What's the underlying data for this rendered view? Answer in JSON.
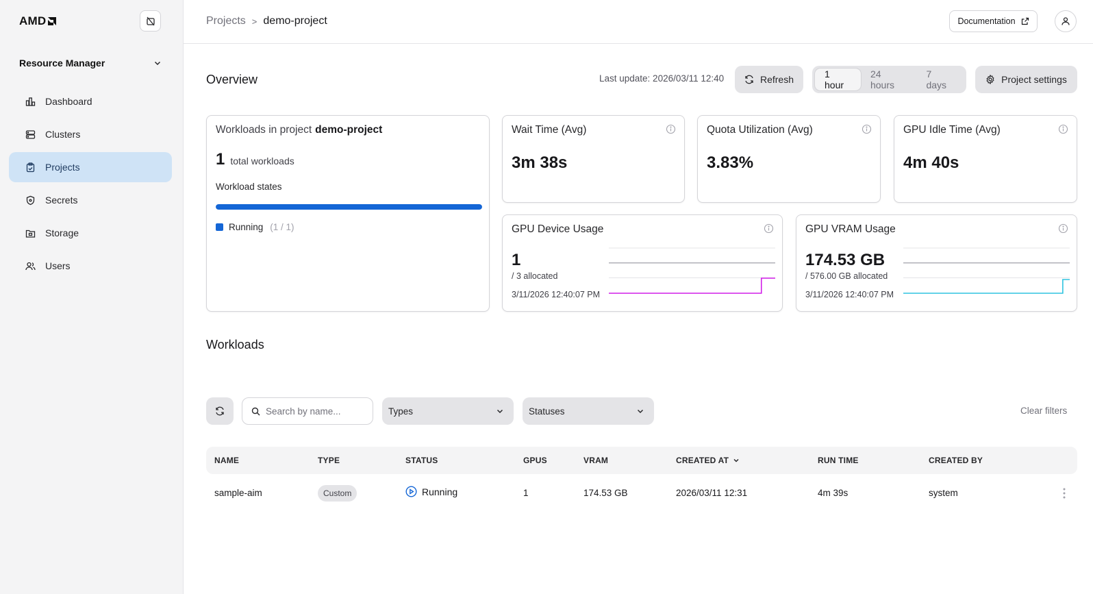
{
  "brand": {
    "name": "AMD"
  },
  "sidebar": {
    "section_label": "Resource Manager",
    "items": [
      {
        "label": "Dashboard",
        "icon": "bar-chart-icon",
        "active": false
      },
      {
        "label": "Clusters",
        "icon": "server-icon",
        "active": false
      },
      {
        "label": "Projects",
        "icon": "clipboard-icon",
        "active": true
      },
      {
        "label": "Secrets",
        "icon": "shield-icon",
        "active": false
      },
      {
        "label": "Storage",
        "icon": "folder-icon",
        "active": false
      },
      {
        "label": "Users",
        "icon": "users-icon",
        "active": false
      }
    ]
  },
  "header": {
    "breadcrumb": {
      "parent": "Projects",
      "separator": ">",
      "current": "demo-project"
    },
    "documentation_label": "Documentation"
  },
  "overview": {
    "title": "Overview",
    "last_update": "Last update: 2026/03/11 12:40",
    "refresh_label": "Refresh",
    "ranges": [
      "1 hour",
      "24 hours",
      "7 days"
    ],
    "selected_range": "1 hour",
    "settings_label": "Project settings"
  },
  "workloads_card": {
    "prefix": "Workloads in project",
    "project": "demo-project",
    "total": "1",
    "total_label": "total workloads",
    "states_label": "Workload states",
    "states": [
      {
        "label": "Running",
        "count": "(1 / 1)",
        "fraction": 1.0,
        "color": "#1466d6"
      }
    ]
  },
  "metrics": {
    "wait_time": {
      "title": "Wait Time (Avg)",
      "value": "3m 38s"
    },
    "quota": {
      "title": "Quota Utilization (Avg)",
      "value": "3.83%"
    },
    "idle": {
      "title": "GPU Idle Time (Avg)",
      "value": "4m 40s"
    },
    "gpu_usage": {
      "title": "GPU Device Usage",
      "value": "1",
      "sub": "/ 3 allocated",
      "timestamp": "3/11/2026 12:40:07 PM",
      "color": "#d11ee8",
      "series": [
        0,
        0,
        0,
        0,
        0,
        0,
        0,
        0,
        0,
        0,
        0,
        0,
        0,
        0,
        0,
        0,
        0,
        0,
        0,
        0,
        0,
        0,
        1,
        1,
        1
      ]
    },
    "vram_usage": {
      "title": "GPU VRAM Usage",
      "value": "174.53 GB",
      "sub": "/ 576.00 GB allocated",
      "timestamp": "3/11/2026 12:40:07 PM",
      "color": "#2ec4e0",
      "series": [
        0,
        0,
        0,
        0,
        0,
        0,
        0,
        0,
        0,
        0,
        0,
        0,
        0,
        0,
        0,
        0,
        0,
        0,
        0,
        0,
        0,
        0,
        0,
        174.53,
        174.53
      ]
    }
  },
  "workloads": {
    "title": "Workloads",
    "search_placeholder": "Search by name...",
    "types_label": "Types",
    "statuses_label": "Statuses",
    "clear_filters": "Clear filters",
    "columns": [
      "NAME",
      "TYPE",
      "STATUS",
      "GPUS",
      "VRAM",
      "CREATED AT",
      "RUN TIME",
      "CREATED BY"
    ],
    "rows": [
      {
        "name": "sample-aim",
        "type": "Custom",
        "status": "Running",
        "gpus": "1",
        "vram": "174.53 GB",
        "created_at": "2026/03/11 12:31",
        "run_time": "4m 39s",
        "created_by": "system"
      }
    ]
  }
}
